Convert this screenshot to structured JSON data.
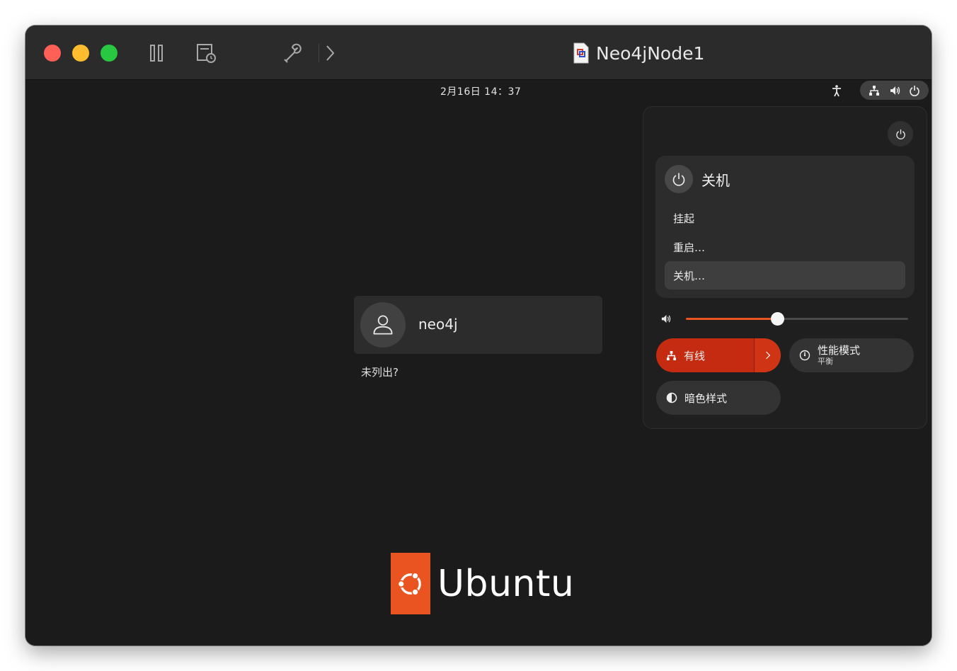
{
  "window": {
    "title": "Neo4jNode1"
  },
  "topbar": {
    "clock": "2月16日  14：37"
  },
  "power_menu": {
    "title": "关机",
    "items": [
      {
        "label": "挂起"
      },
      {
        "label": "重启…"
      },
      {
        "label": "关机…"
      }
    ],
    "highlighted_item": "关机…"
  },
  "volume": {
    "level": 0.41
  },
  "quick_settings": {
    "wired": {
      "label": "有线",
      "active": true
    },
    "performance": {
      "label": "性能模式",
      "sublabel": "平衡"
    },
    "dark_style": {
      "label": "暗色样式"
    }
  },
  "login": {
    "username": "neo4j",
    "not_listed": "未列出?"
  },
  "logo": {
    "text": "Ubuntu"
  },
  "colors": {
    "accent": "#e95420",
    "active_toggle": "#c42b10",
    "background": "#1b1b1b"
  }
}
